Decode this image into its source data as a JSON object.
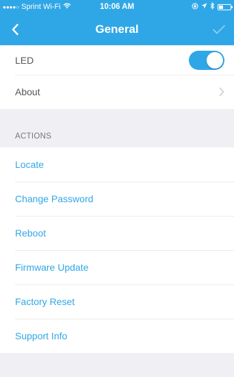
{
  "status_bar": {
    "carrier": "Sprint Wi-Fi",
    "time": "10:06 AM"
  },
  "nav": {
    "title": "General"
  },
  "settings": {
    "led_label": "LED",
    "led_enabled": true,
    "about_label": "About"
  },
  "actions": {
    "header": "ACTIONS",
    "items": [
      "Locate",
      "Change Password",
      "Reboot",
      "Firmware Update",
      "Factory Reset",
      "Support Info"
    ]
  },
  "colors": {
    "accent": "#2fa7e6",
    "background": "#efeff4"
  },
  "icons": {
    "back": "chevron-left-icon",
    "done": "checkmark-icon",
    "about": "chevron-right-icon"
  }
}
